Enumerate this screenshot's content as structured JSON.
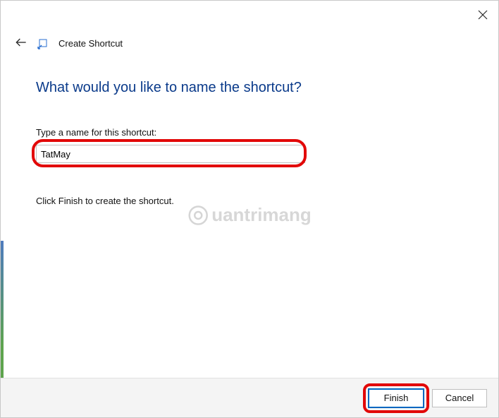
{
  "header": {
    "title": "Create Shortcut"
  },
  "main": {
    "heading": "What would you like to name the shortcut?",
    "field_label": "Type a name for this shortcut:",
    "input_value": "TatMay",
    "instruction": "Click Finish to create the shortcut."
  },
  "footer": {
    "finish_label": "Finish",
    "cancel_label": "Cancel"
  },
  "watermark": {
    "text": "uantrimang"
  }
}
